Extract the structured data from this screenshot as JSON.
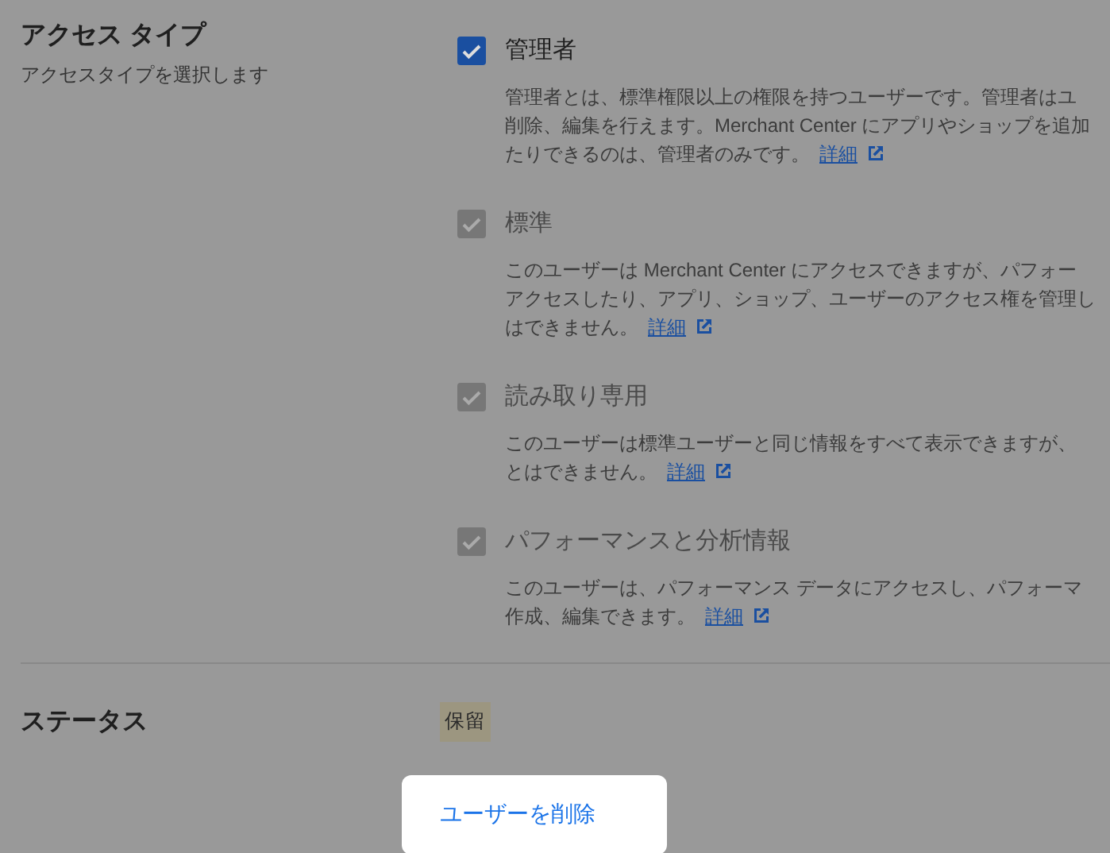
{
  "access_type": {
    "title": "アクセス タイプ",
    "subtitle": "アクセスタイプを選択します",
    "options": [
      {
        "label": "管理者",
        "checked": true,
        "disabled": false,
        "description": [
          "管理者とは、標準権限以上の権限を持つユーザーです。管理者はユ",
          "削除、編集を行えます。Merchant Center にアプリやショップを追加",
          "たりできるのは、管理者のみです。"
        ],
        "link": "詳細"
      },
      {
        "label": "標準",
        "checked": true,
        "disabled": true,
        "description": [
          "このユーザーは Merchant Center にアクセスできますが、パフォー",
          "アクセスしたり、アプリ、ショップ、ユーザーのアクセス権を管理し",
          "はできません。"
        ],
        "link": "詳細"
      },
      {
        "label": "読み取り専用",
        "checked": true,
        "disabled": true,
        "description": [
          "このユーザーは標準ユーザーと同じ情報をすべて表示できますが、",
          "とはできません。"
        ],
        "link": "詳細"
      },
      {
        "label": "パフォーマンスと分析情報",
        "checked": true,
        "disabled": true,
        "description": [
          "このユーザーは、パフォーマンス データにアクセスし、パフォーマ",
          "作成、編集できます。"
        ],
        "link": "詳細"
      }
    ]
  },
  "status": {
    "title": "ステータス",
    "badge": "保留"
  },
  "delete_button": "ユーザーを削除"
}
